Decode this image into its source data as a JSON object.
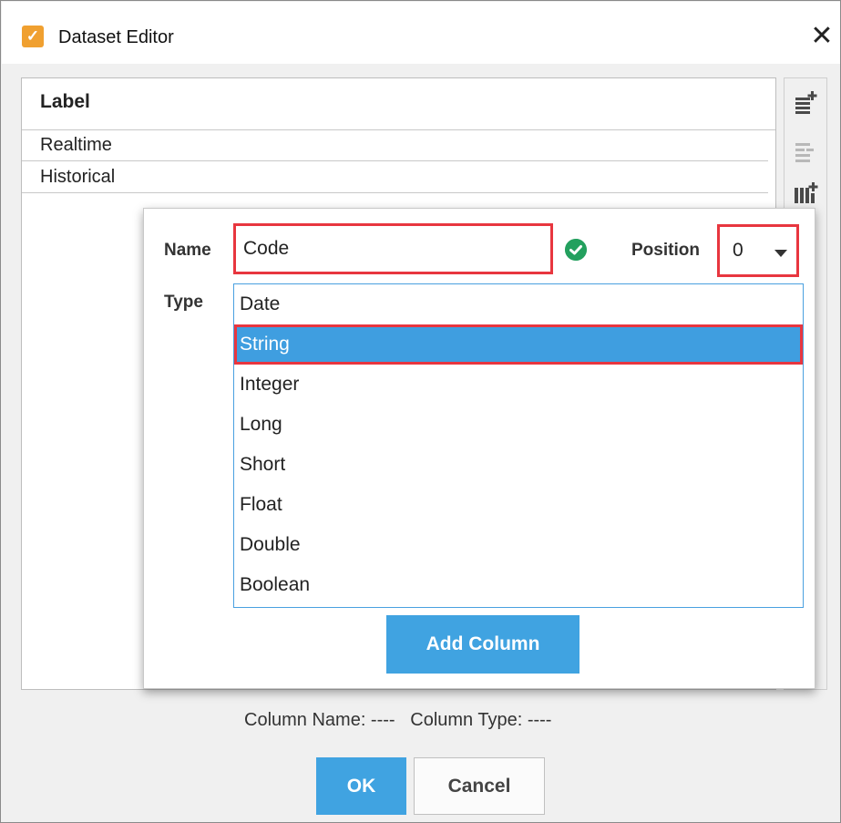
{
  "window": {
    "title": "Dataset Editor",
    "close_glyph": "✕",
    "app_icon": "dataset-editor-icon"
  },
  "table": {
    "header": "Label",
    "rows": [
      "Realtime",
      "Historical"
    ]
  },
  "side_toolbar": {
    "icons": [
      "add-row-icon",
      "remove-row-icon",
      "add-column-icon"
    ]
  },
  "popup": {
    "name_label": "Name",
    "name_value": "Code",
    "valid_icon": "check-circle-icon",
    "position_label": "Position",
    "position_value": "0",
    "type_label": "Type",
    "types": [
      "Date",
      "String",
      "Integer",
      "Long",
      "Short",
      "Float",
      "Double",
      "Boolean"
    ],
    "selected_type": "String",
    "add_button": "Add Column"
  },
  "footer": {
    "column_info": "Column Name: ----   Column Type: ----",
    "ok": "OK",
    "cancel": "Cancel"
  },
  "colors": {
    "accent": "#40a3e1",
    "highlight": "#e8363f",
    "valid": "#23a05e"
  }
}
